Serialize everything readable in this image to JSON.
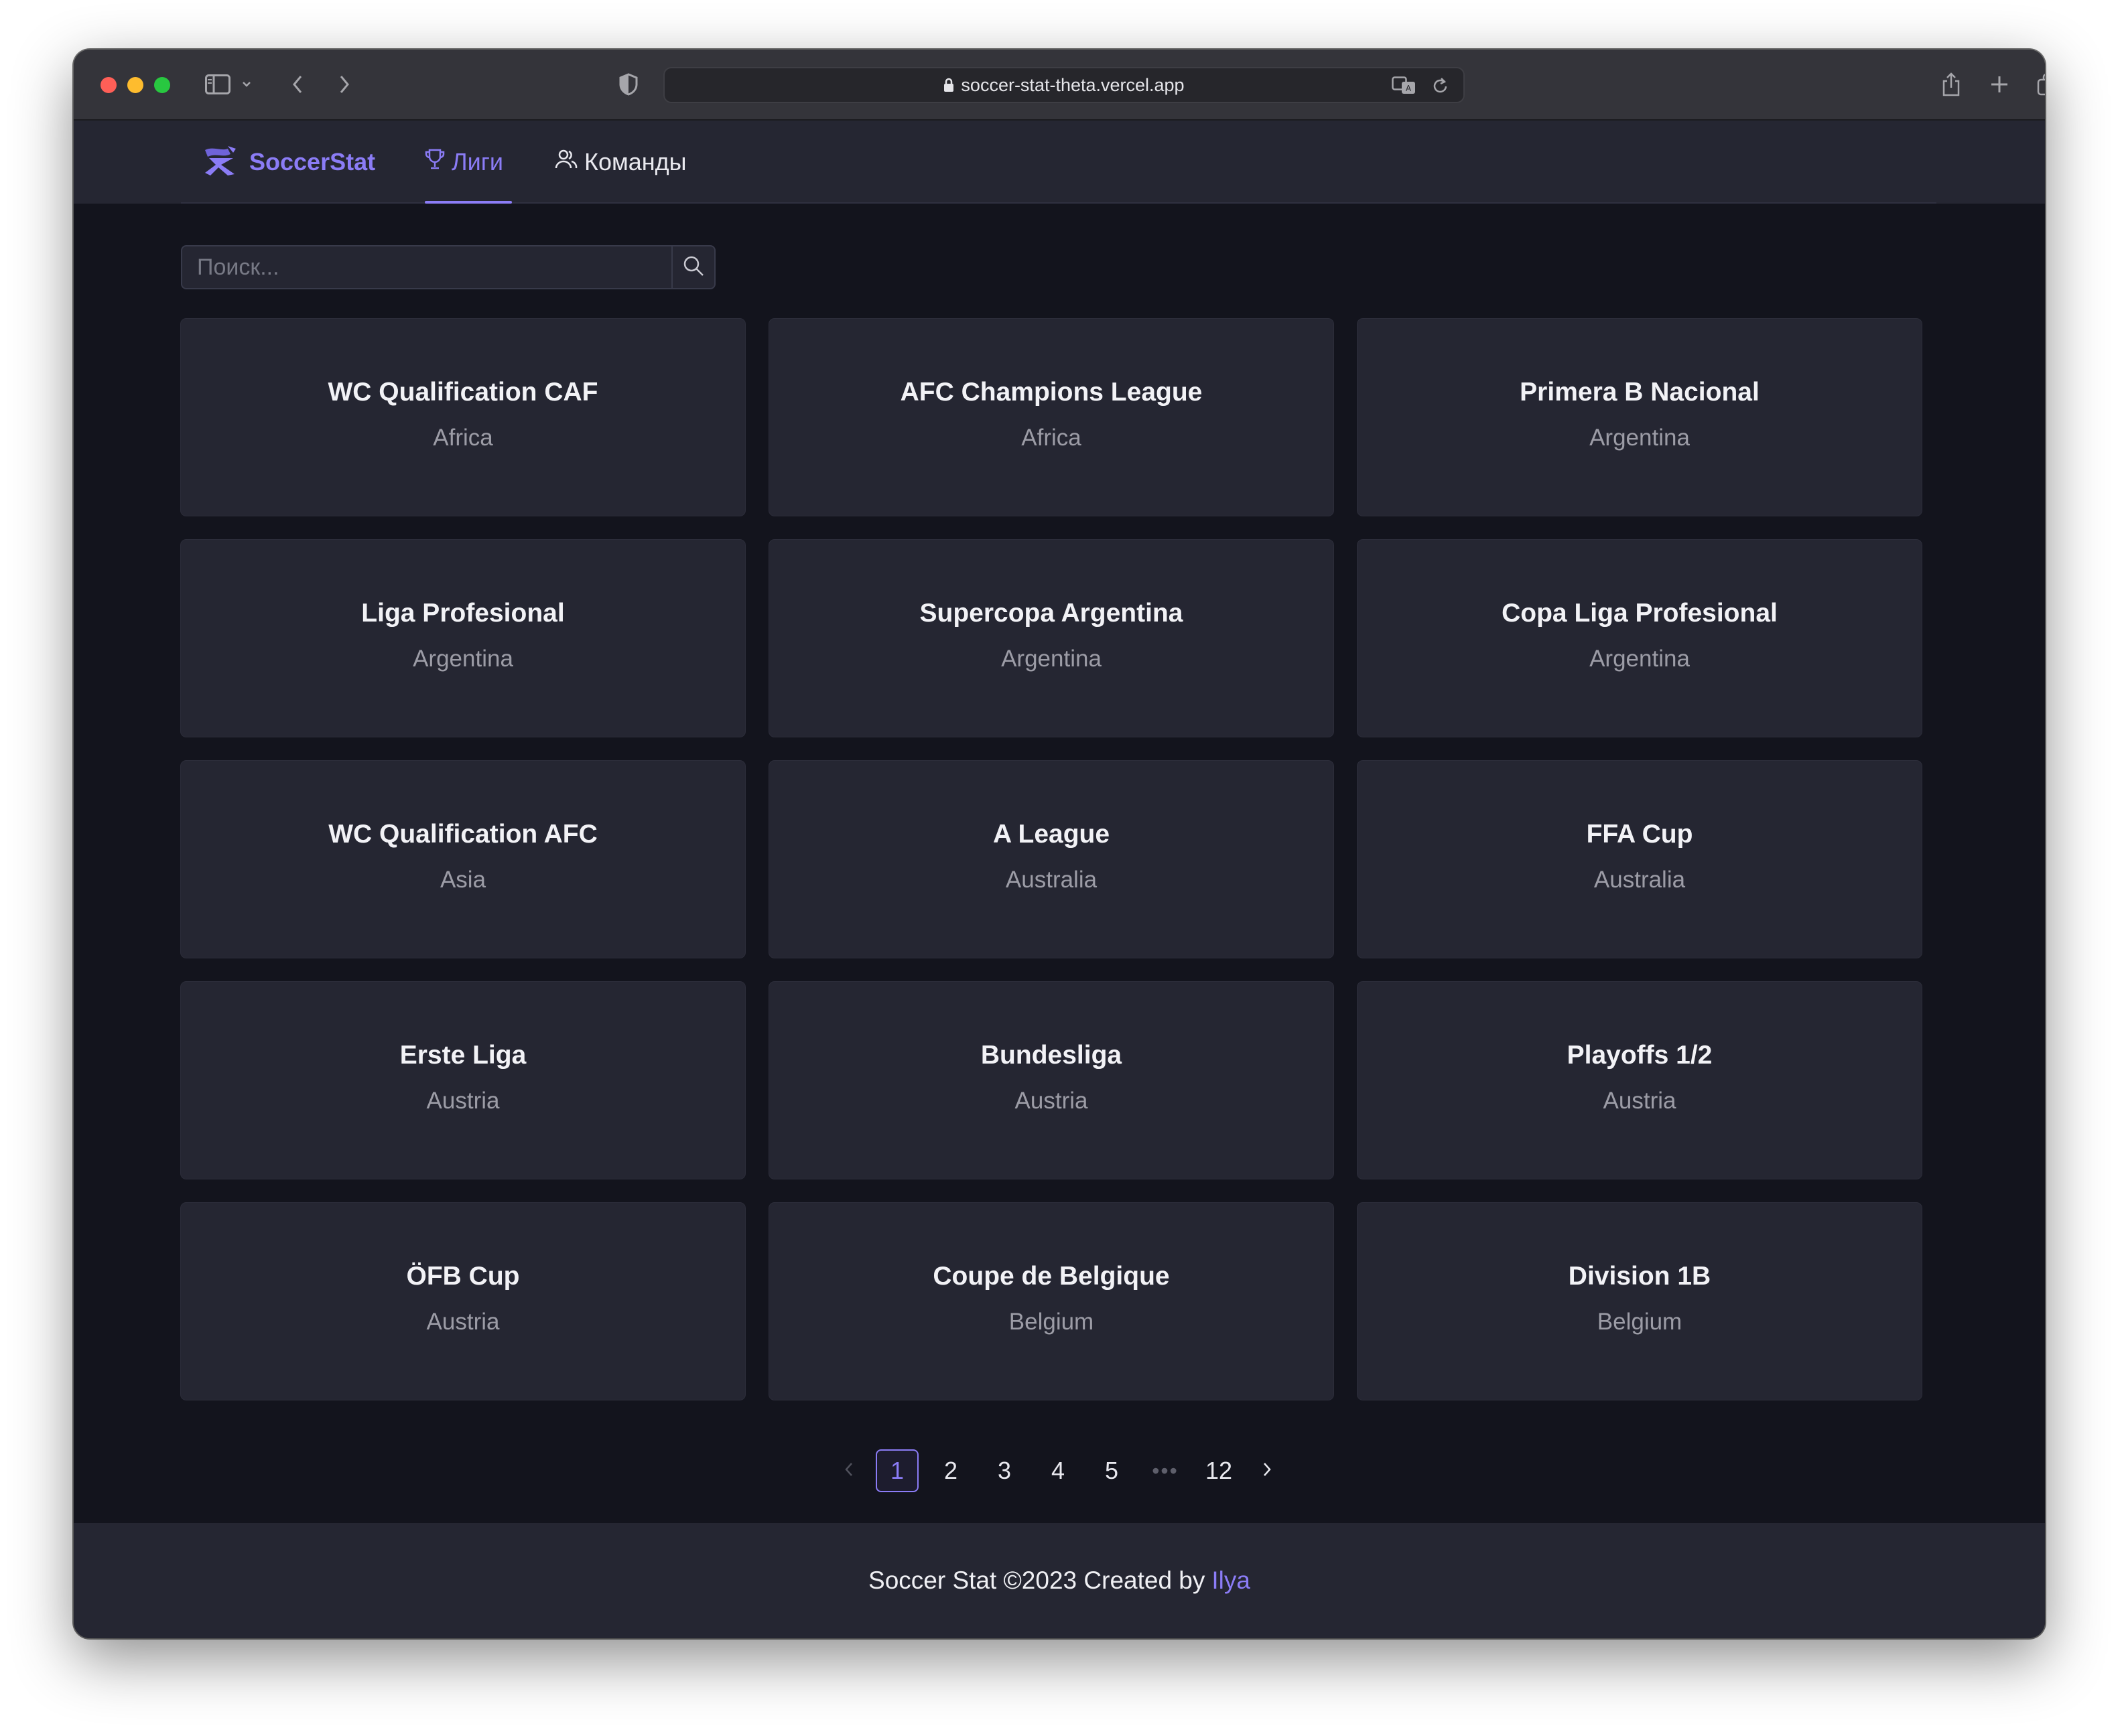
{
  "browser": {
    "url": "soccer-stat-theta.vercel.app"
  },
  "header": {
    "logo_text": "SoccerStat",
    "nav": [
      {
        "label": "Лиги",
        "active": true
      },
      {
        "label": "Команды",
        "active": false
      }
    ]
  },
  "search": {
    "placeholder": "Поиск..."
  },
  "leagues": [
    {
      "name": "WC Qualification CAF",
      "country": "Africa"
    },
    {
      "name": "AFC Champions League",
      "country": "Africa"
    },
    {
      "name": "Primera B Nacional",
      "country": "Argentina"
    },
    {
      "name": "Liga Profesional",
      "country": "Argentina"
    },
    {
      "name": "Supercopa Argentina",
      "country": "Argentina"
    },
    {
      "name": "Copa Liga Profesional",
      "country": "Argentina"
    },
    {
      "name": "WC Qualification AFC",
      "country": "Asia"
    },
    {
      "name": "A League",
      "country": "Australia"
    },
    {
      "name": "FFA Cup",
      "country": "Australia"
    },
    {
      "name": "Erste Liga",
      "country": "Austria"
    },
    {
      "name": "Bundesliga",
      "country": "Austria"
    },
    {
      "name": "Playoffs 1/2",
      "country": "Austria"
    },
    {
      "name": "ÖFB Cup",
      "country": "Austria"
    },
    {
      "name": "Coupe de Belgique",
      "country": "Belgium"
    },
    {
      "name": "Division 1B",
      "country": "Belgium"
    }
  ],
  "pagination": {
    "pages": [
      "1",
      "2",
      "3",
      "4",
      "5"
    ],
    "ellipsis": "•••",
    "last": "12",
    "current": "1"
  },
  "footer": {
    "text": "Soccer Stat ©2023 Created by",
    "link": "Ilya"
  },
  "colors": {
    "accent": "#8b7cf6",
    "page_bg": "#13141d",
    "card_bg": "#252632"
  }
}
